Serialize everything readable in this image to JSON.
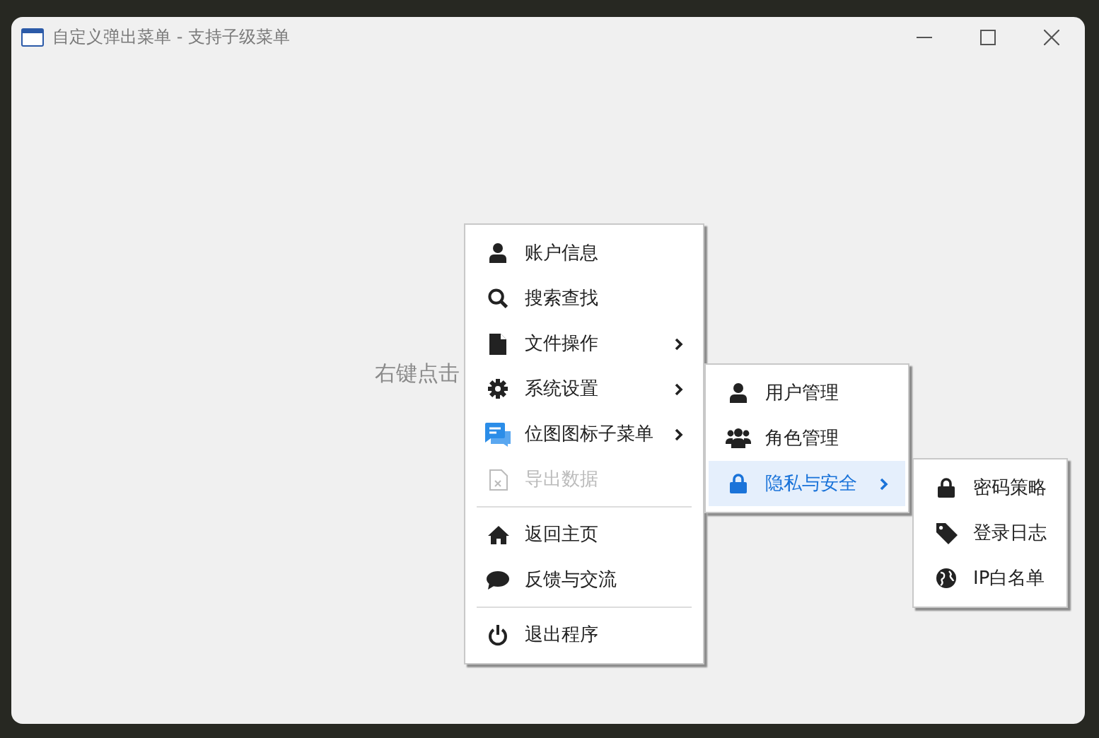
{
  "window": {
    "title": "自定义弹出菜单 - 支持子级菜单"
  },
  "hint": "右键点击",
  "menus": [
    {
      "items": [
        {
          "kind": "item",
          "label": "账户信息",
          "has_submenu": false,
          "disabled": false,
          "selected": false
        },
        {
          "kind": "item",
          "label": "搜索查找",
          "has_submenu": false,
          "disabled": false,
          "selected": false
        },
        {
          "kind": "item",
          "label": "文件操作",
          "has_submenu": true,
          "disabled": false,
          "selected": false
        },
        {
          "kind": "item",
          "label": "系统设置",
          "has_submenu": true,
          "disabled": false,
          "selected": false
        },
        {
          "kind": "item",
          "label": "位图图标子菜单",
          "has_submenu": true,
          "disabled": false,
          "selected": false
        },
        {
          "kind": "item",
          "label": "导出数据",
          "has_submenu": false,
          "disabled": true,
          "selected": false
        },
        {
          "kind": "separator"
        },
        {
          "kind": "item",
          "label": "返回主页",
          "has_submenu": false,
          "disabled": false,
          "selected": false
        },
        {
          "kind": "item",
          "label": "反馈与交流",
          "has_submenu": false,
          "disabled": false,
          "selected": false
        },
        {
          "kind": "separator"
        },
        {
          "kind": "item",
          "label": "退出程序",
          "has_submenu": false,
          "disabled": false,
          "selected": false
        }
      ]
    },
    {
      "items": [
        {
          "kind": "item",
          "label": "用户管理",
          "has_submenu": false,
          "disabled": false,
          "selected": false
        },
        {
          "kind": "item",
          "label": "角色管理",
          "has_submenu": false,
          "disabled": false,
          "selected": false
        },
        {
          "kind": "item",
          "label": "隐私与安全",
          "has_submenu": true,
          "disabled": false,
          "selected": true
        }
      ]
    },
    {
      "items": [
        {
          "kind": "item",
          "label": "密码策略",
          "has_submenu": false,
          "disabled": false,
          "selected": false
        },
        {
          "kind": "item",
          "label": "登录日志",
          "has_submenu": false,
          "disabled": false,
          "selected": false
        },
        {
          "kind": "item",
          "label": "IP白名单",
          "has_submenu": false,
          "disabled": false,
          "selected": false
        }
      ]
    }
  ]
}
